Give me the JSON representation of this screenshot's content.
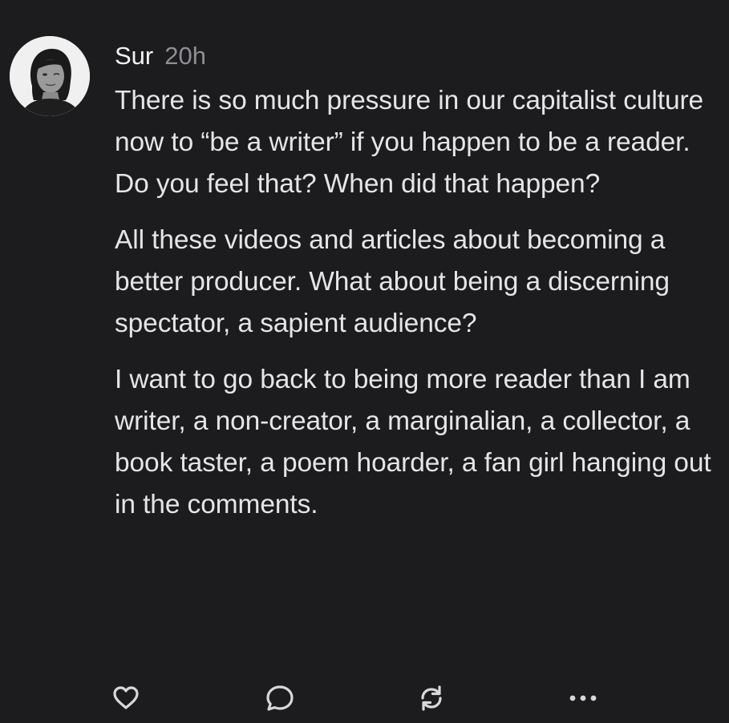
{
  "post": {
    "author": "Sur",
    "time": "20h",
    "paragraphs": [
      "There is so much pressure in our capitalist culture now to “be a writer” if you happen to be a reader. Do you feel that? When did that happen?",
      "All these videos and articles about becoming a better producer. What about being a discerning spectator, a sapient audience?",
      "I want to go back to being more reader than I am writer, a non-creator, a marginalian, a collector, a book taster, a poem hoarder, a fan girl hanging out in the comments."
    ]
  },
  "actions": {
    "like_icon": "heart-icon",
    "comment_icon": "speech-bubble-icon",
    "restack_icon": "restack-arrows-icon",
    "more_icon": "ellipsis-icon"
  },
  "colors": {
    "background": "#1c1c1e",
    "text": "#e5e5e7",
    "secondary_text": "#8e8e93",
    "icon": "#d8d8dc"
  }
}
